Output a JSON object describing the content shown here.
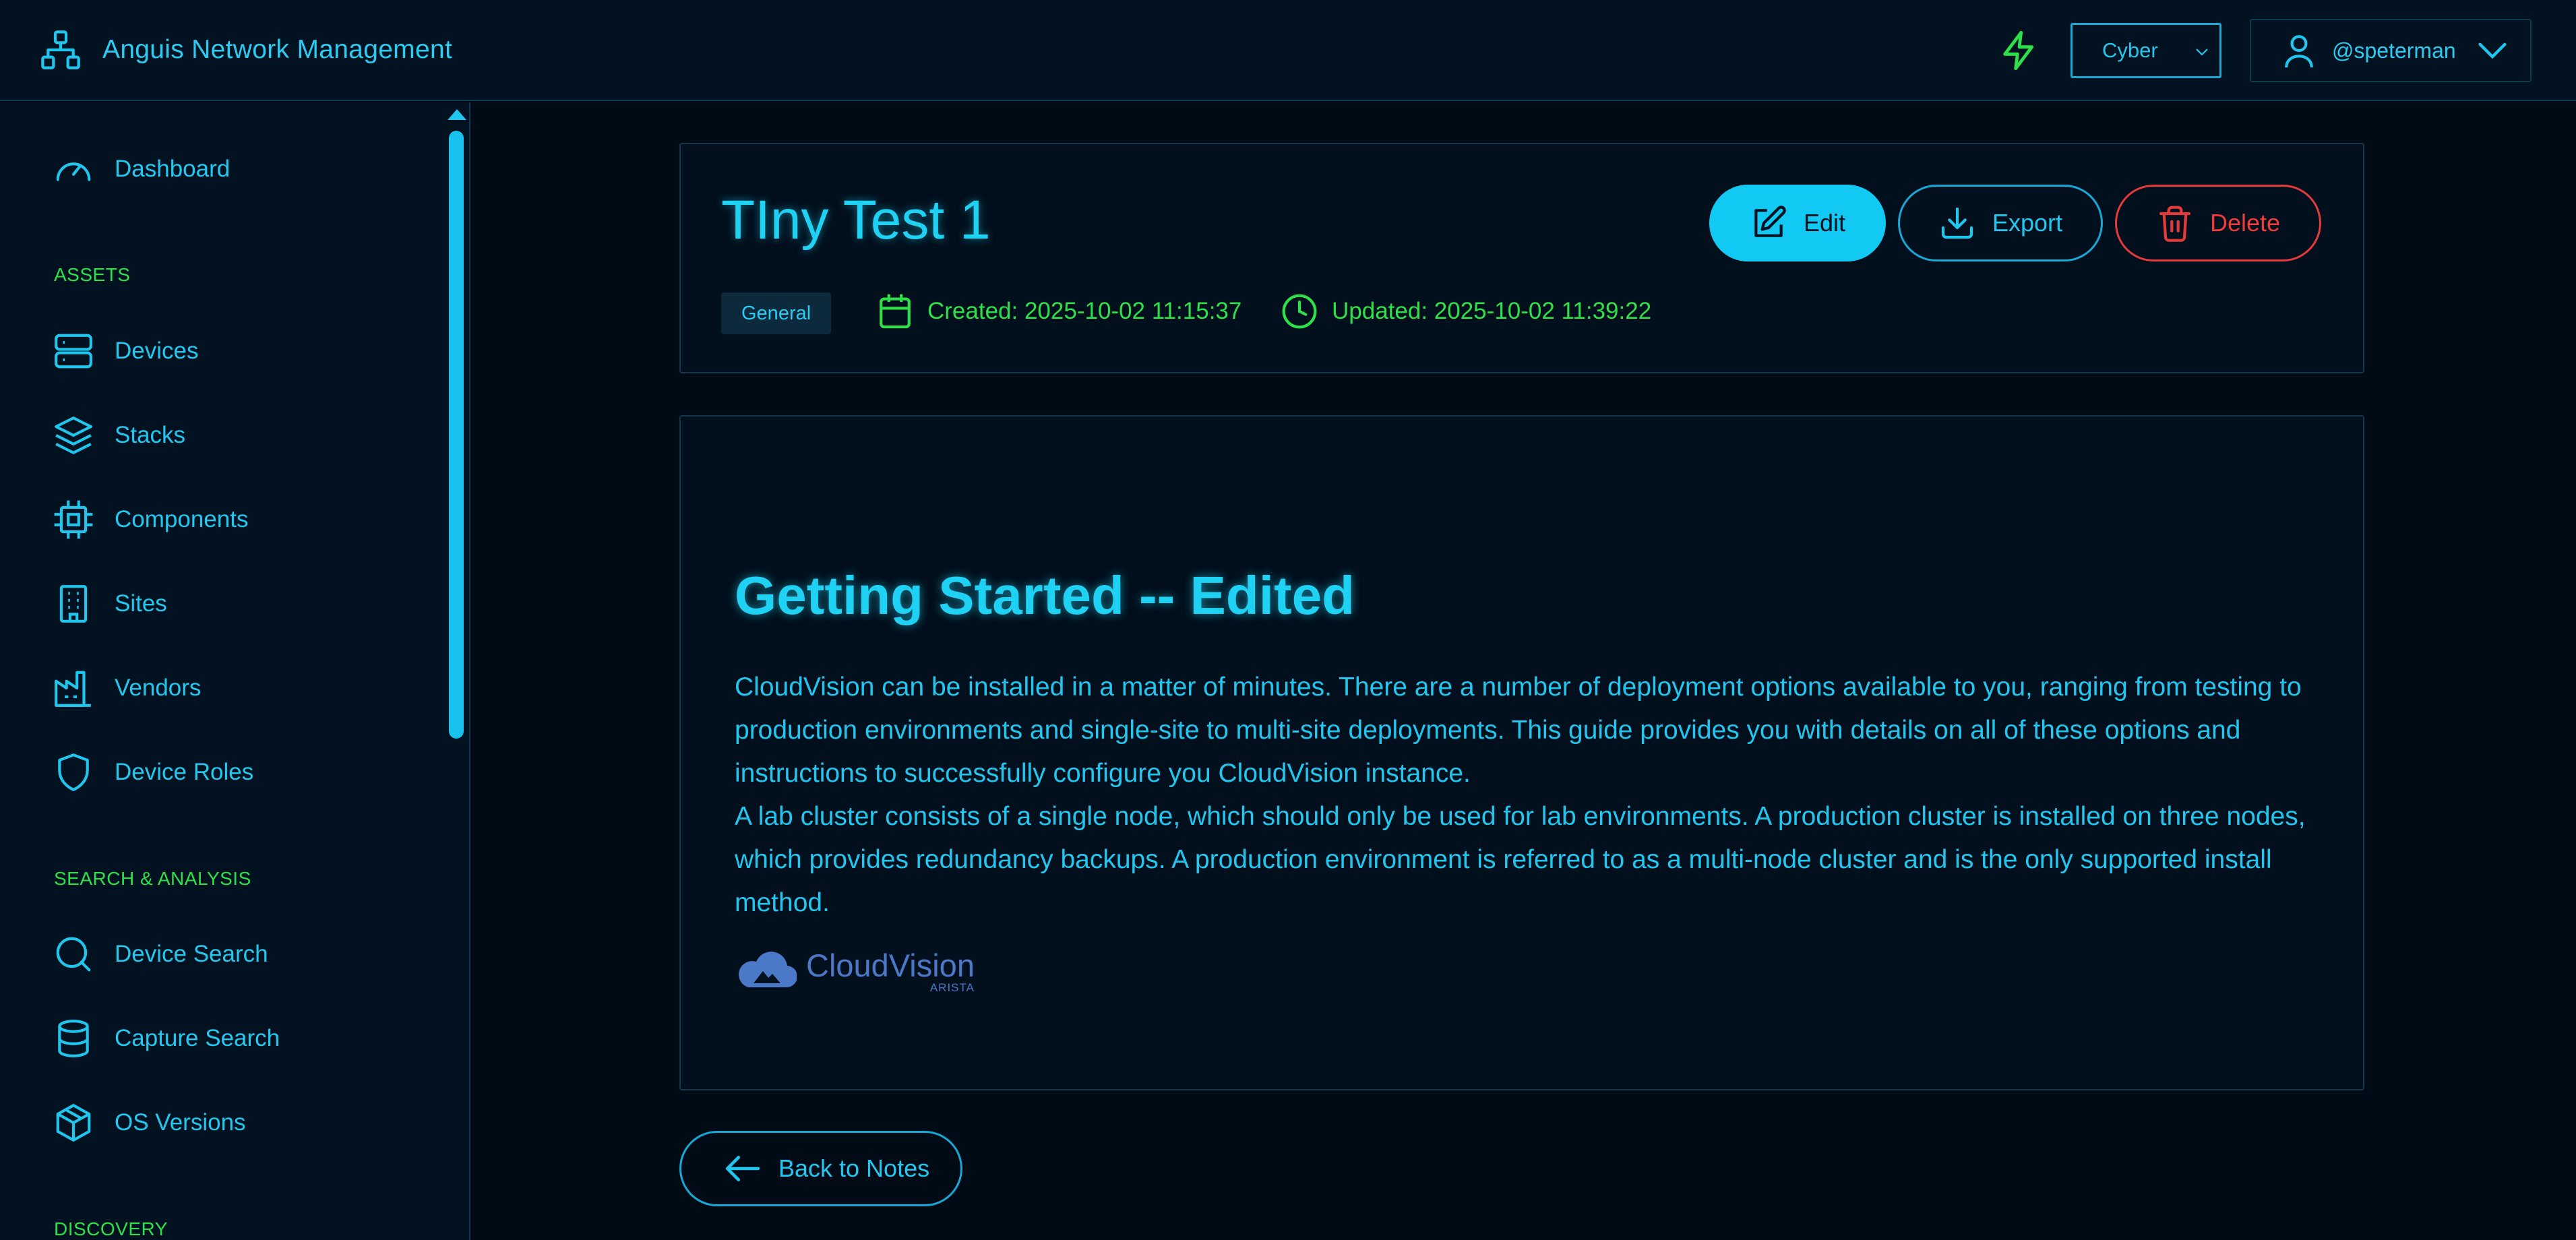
{
  "header": {
    "app_title": "Anguis Network Management",
    "theme_value": "Cyber",
    "username": "@speterman",
    "icons": [
      "network-icon",
      "bolt-icon",
      "chevron-down-icon",
      "user-icon"
    ]
  },
  "sidebar": {
    "items": [
      {
        "label": "Dashboard",
        "icon": "speedometer-icon"
      },
      {
        "section": "ASSETS"
      },
      {
        "label": "Devices",
        "icon": "server-icon"
      },
      {
        "label": "Stacks",
        "icon": "layers-icon"
      },
      {
        "label": "Components",
        "icon": "chip-icon"
      },
      {
        "label": "Sites",
        "icon": "building-icon"
      },
      {
        "label": "Vendors",
        "icon": "factory-icon"
      },
      {
        "label": "Device Roles",
        "icon": "shield-icon"
      },
      {
        "section": "SEARCH & ANALYSIS"
      },
      {
        "label": "Device Search",
        "icon": "search-icon"
      },
      {
        "label": "Capture Search",
        "icon": "database-icon"
      },
      {
        "label": "OS Versions",
        "icon": "package-icon"
      },
      {
        "section": "DISCOVERY"
      }
    ]
  },
  "note": {
    "title": "TIny Test 1",
    "category": "General",
    "created": "Created: 2025-10-02 11:15:37",
    "updated": "Updated: 2025-10-02 11:39:22",
    "actions": {
      "edit": "Edit",
      "export": "Export",
      "delete": "Delete"
    },
    "content": {
      "heading": "Getting Started -- Edited",
      "paragraph1": "CloudVision can be installed in a matter of minutes. There are a number of deployment options available to you, ranging from testing to production environments and single-site to multi-site deployments. This guide provides you with details on all of these options and instructions to successfully configure you CloudVision instance.",
      "paragraph2": "A lab cluster consists of a single node, which should only be used for lab environments. A production cluster is installed on three nodes, which provides redundancy backups. A production environment is referred to as a multi-node cluster and is the only supported install method.",
      "logo_text": "CloudVision",
      "logo_subtext": "ARISTA"
    }
  },
  "back_label": "Back to Notes",
  "colors": {
    "background": "#010b16",
    "panel": "#021220",
    "accent": "#1fc6ee",
    "green": "#2ee04a",
    "danger": "#e43a3a"
  }
}
